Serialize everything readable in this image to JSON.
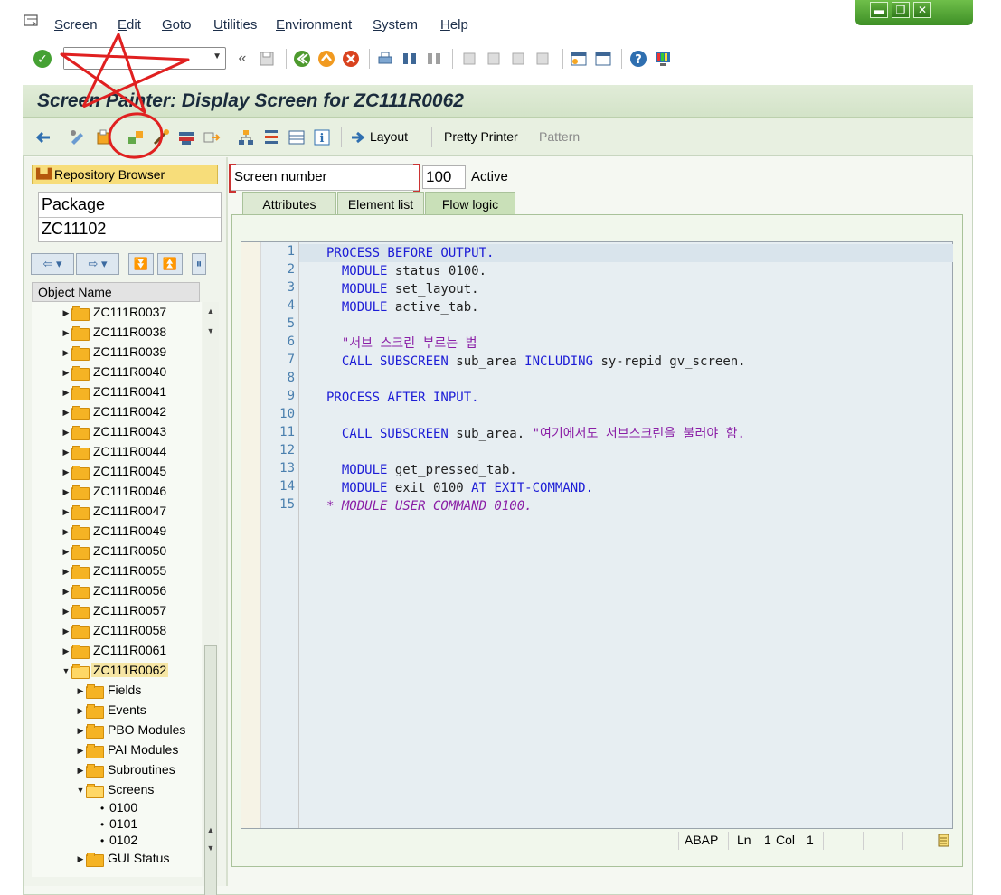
{
  "menubar": {
    "items": [
      "Screen",
      "Edit",
      "Goto",
      "Utilities",
      "Environment",
      "System",
      "Help"
    ]
  },
  "window_controls": {
    "minimize": "▬",
    "maximize": "❐",
    "close": "✕"
  },
  "standard_toolbar": {
    "command_field": {
      "value": "",
      "placeholder": ""
    },
    "icons": [
      "enter-icon",
      "back-arrows-icon",
      "save-icon",
      "back-icon",
      "exit-icon",
      "cancel-icon",
      "print-icon",
      "find-icon",
      "find-next-icon",
      "first-page-icon",
      "previous-page-icon",
      "next-page-icon",
      "last-page-icon",
      "new-session-icon",
      "shortcut-icon",
      "help-icon",
      "customize-layout-icon"
    ]
  },
  "title": "Screen Painter: Display Screen for ZC111R0062",
  "app_toolbar": {
    "layout_label": "Layout",
    "pretty_printer_label": "Pretty Printer",
    "pattern_label": "Pattern"
  },
  "left_pane": {
    "repository_browser_label": "Repository Browser",
    "object_type": "Package",
    "object_name": "ZC11102",
    "tree_header": "Object Name",
    "tree": [
      {
        "label": "ZC111R0037",
        "level": 1,
        "icon": "folder",
        "expander": "▶"
      },
      {
        "label": "ZC111R0038",
        "level": 1,
        "icon": "folder",
        "expander": "▶"
      },
      {
        "label": "ZC111R0039",
        "level": 1,
        "icon": "folder",
        "expander": "▶"
      },
      {
        "label": "ZC111R0040",
        "level": 1,
        "icon": "folder",
        "expander": "▶"
      },
      {
        "label": "ZC111R0041",
        "level": 1,
        "icon": "folder",
        "expander": "▶"
      },
      {
        "label": "ZC111R0042",
        "level": 1,
        "icon": "folder",
        "expander": "▶"
      },
      {
        "label": "ZC111R0043",
        "level": 1,
        "icon": "folder",
        "expander": "▶"
      },
      {
        "label": "ZC111R0044",
        "level": 1,
        "icon": "folder",
        "expander": "▶"
      },
      {
        "label": "ZC111R0045",
        "level": 1,
        "icon": "folder",
        "expander": "▶"
      },
      {
        "label": "ZC111R0046",
        "level": 1,
        "icon": "folder",
        "expander": "▶"
      },
      {
        "label": "ZC111R0047",
        "level": 1,
        "icon": "folder",
        "expander": "▶"
      },
      {
        "label": "ZC111R0049",
        "level": 1,
        "icon": "folder",
        "expander": "▶"
      },
      {
        "label": "ZC111R0050",
        "level": 1,
        "icon": "folder",
        "expander": "▶"
      },
      {
        "label": "ZC111R0055",
        "level": 1,
        "icon": "folder",
        "expander": "▶"
      },
      {
        "label": "ZC111R0056",
        "level": 1,
        "icon": "folder",
        "expander": "▶"
      },
      {
        "label": "ZC111R0057",
        "level": 1,
        "icon": "folder",
        "expander": "▶"
      },
      {
        "label": "ZC111R0058",
        "level": 1,
        "icon": "folder",
        "expander": "▶"
      },
      {
        "label": "ZC111R0061",
        "level": 1,
        "icon": "folder",
        "expander": "▶"
      },
      {
        "label": "ZC111R0062",
        "level": 1,
        "icon": "folder-open",
        "expander": "▼",
        "selected": true
      },
      {
        "label": "Fields",
        "level": 2,
        "icon": "folder",
        "expander": "▶"
      },
      {
        "label": "Events",
        "level": 2,
        "icon": "folder",
        "expander": "▶"
      },
      {
        "label": "PBO Modules",
        "level": 2,
        "icon": "folder",
        "expander": "▶"
      },
      {
        "label": "PAI Modules",
        "level": 2,
        "icon": "folder",
        "expander": "▶"
      },
      {
        "label": "Subroutines",
        "level": 2,
        "icon": "folder",
        "expander": "▶"
      },
      {
        "label": "Screens",
        "level": 2,
        "icon": "folder-open",
        "expander": "▼"
      },
      {
        "label": "0100",
        "level": 3,
        "icon": "bullet",
        "expander": ""
      },
      {
        "label": "0101",
        "level": 3,
        "icon": "bullet",
        "expander": ""
      },
      {
        "label": "0102",
        "level": 3,
        "icon": "bullet",
        "expander": ""
      },
      {
        "label": "GUI Status",
        "level": 2,
        "icon": "folder",
        "expander": "▶"
      }
    ]
  },
  "screen_header": {
    "label": "Screen number",
    "number": "100",
    "status": "Active"
  },
  "tabs": [
    {
      "label": "Attributes",
      "active": false
    },
    {
      "label": "Element list",
      "active": false
    },
    {
      "label": "Flow logic",
      "active": true
    }
  ],
  "editor": {
    "lines": [
      [
        [
          "kw",
          "PROCESS BEFORE OUTPUT."
        ]
      ],
      [
        [
          "kw",
          "  MODULE "
        ],
        [
          "id",
          "status_0100."
        ]
      ],
      [
        [
          "kw",
          "  MODULE "
        ],
        [
          "id",
          "set_layout."
        ]
      ],
      [
        [
          "kw",
          "  MODULE "
        ],
        [
          "id",
          "active_tab."
        ]
      ],
      [],
      [
        [
          "st",
          "  \"서브 스크린 부르는 법"
        ]
      ],
      [
        [
          "kw",
          "  CALL SUBSCREEN "
        ],
        [
          "id",
          "sub_area "
        ],
        [
          "kw",
          "INCLUDING "
        ],
        [
          "id",
          "sy-repid gv_screen."
        ]
      ],
      [],
      [
        [
          "kw",
          "PROCESS AFTER INPUT."
        ]
      ],
      [],
      [
        [
          "kw",
          "  CALL SUBSCREEN "
        ],
        [
          "id",
          "sub_area. "
        ],
        [
          "st",
          "\"여기에서도 서브스크린을 불러야 함."
        ]
      ],
      [],
      [
        [
          "kw",
          "  MODULE "
        ],
        [
          "id",
          "get_pressed_tab."
        ]
      ],
      [
        [
          "kw",
          "  MODULE "
        ],
        [
          "id",
          "exit_0100 "
        ],
        [
          "kw",
          "AT EXIT-COMMAND."
        ]
      ],
      [
        [
          "cm",
          "* MODULE USER_COMMAND_0100."
        ]
      ]
    ],
    "status": {
      "language": "ABAP",
      "ln_label": "Ln",
      "ln_value": "1",
      "col_label": "Col",
      "col_value": "1"
    }
  },
  "annotation_color": "#e02020"
}
